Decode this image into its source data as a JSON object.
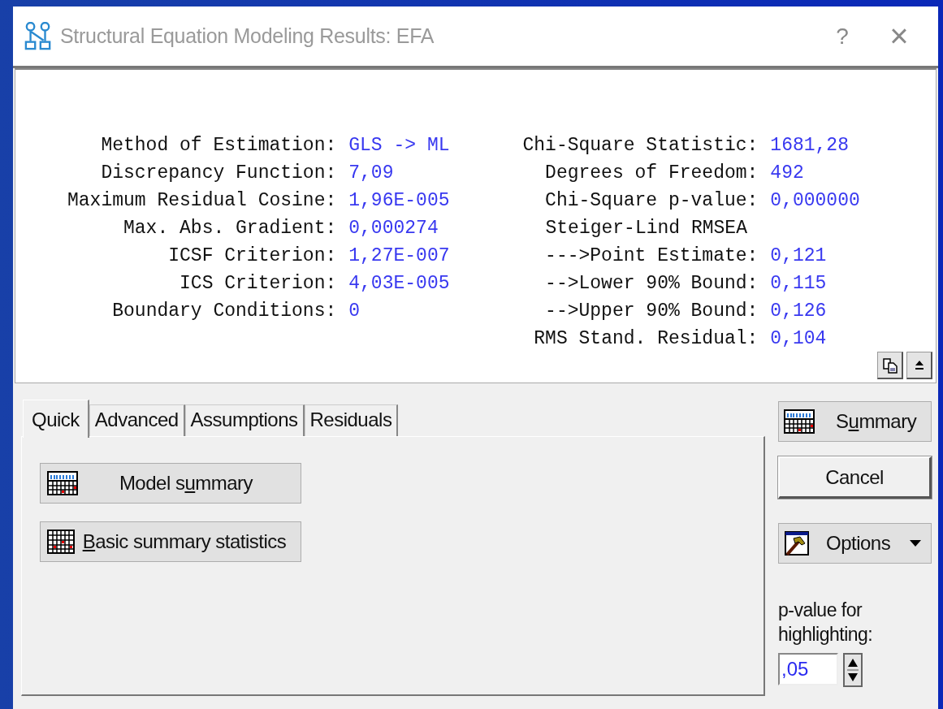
{
  "window": {
    "title": "Structural Equation Modeling Results: EFA",
    "help": "?",
    "close": "×"
  },
  "results": {
    "left": [
      {
        "label": "Method of Estimation:",
        "value": "GLS -> ML"
      },
      {
        "label": "Discrepancy Function:",
        "value": "7,09"
      },
      {
        "label": "Maximum Residual Cosine:",
        "value": "1,96E-005"
      },
      {
        "label": "Max. Abs. Gradient:",
        "value": "0,000274"
      },
      {
        "label": "ICSF Criterion:",
        "value": "1,27E-007"
      },
      {
        "label": "ICS Criterion:",
        "value": "4,03E-005"
      },
      {
        "label": "Boundary Conditions:",
        "value": "0"
      }
    ],
    "right": [
      {
        "label": "Chi-Square Statistic:",
        "value": "1681,28"
      },
      {
        "label": "Degrees of Freedom:",
        "value": "492"
      },
      {
        "label": "Chi-Square p-value:",
        "value": "0,000000"
      },
      {
        "label": "Steiger-Lind RMSEA",
        "kind": "heading"
      },
      {
        "label": "--->Point Estimate:",
        "value": "0,121"
      },
      {
        "label": "-->Lower 90% Bound:",
        "value": "0,115"
      },
      {
        "label": "-->Upper 90% Bound:",
        "value": "0,126"
      },
      {
        "label": "RMS Stand. Residual:",
        "value": "0,104"
      }
    ]
  },
  "tabs": [
    {
      "label": "Quick",
      "selected": true
    },
    {
      "label": "Advanced",
      "selected": false
    },
    {
      "label": "Assumptions",
      "selected": false
    },
    {
      "label": "Residuals",
      "selected": false
    }
  ],
  "quick_buttons": [
    {
      "kind": "summary",
      "label": {
        "before": "Model s",
        "key": "u",
        "after": "mmary"
      }
    },
    {
      "kind": "statistics",
      "label": {
        "key": "B",
        "after": "asic summary statistics"
      }
    }
  ],
  "side": {
    "summary": {
      "before": "S",
      "key": "u",
      "after": "mmary"
    },
    "cancel": "Cancel",
    "options": "Options",
    "pvalue_label": "p-value for highlighting:",
    "pvalue": ",05"
  }
}
